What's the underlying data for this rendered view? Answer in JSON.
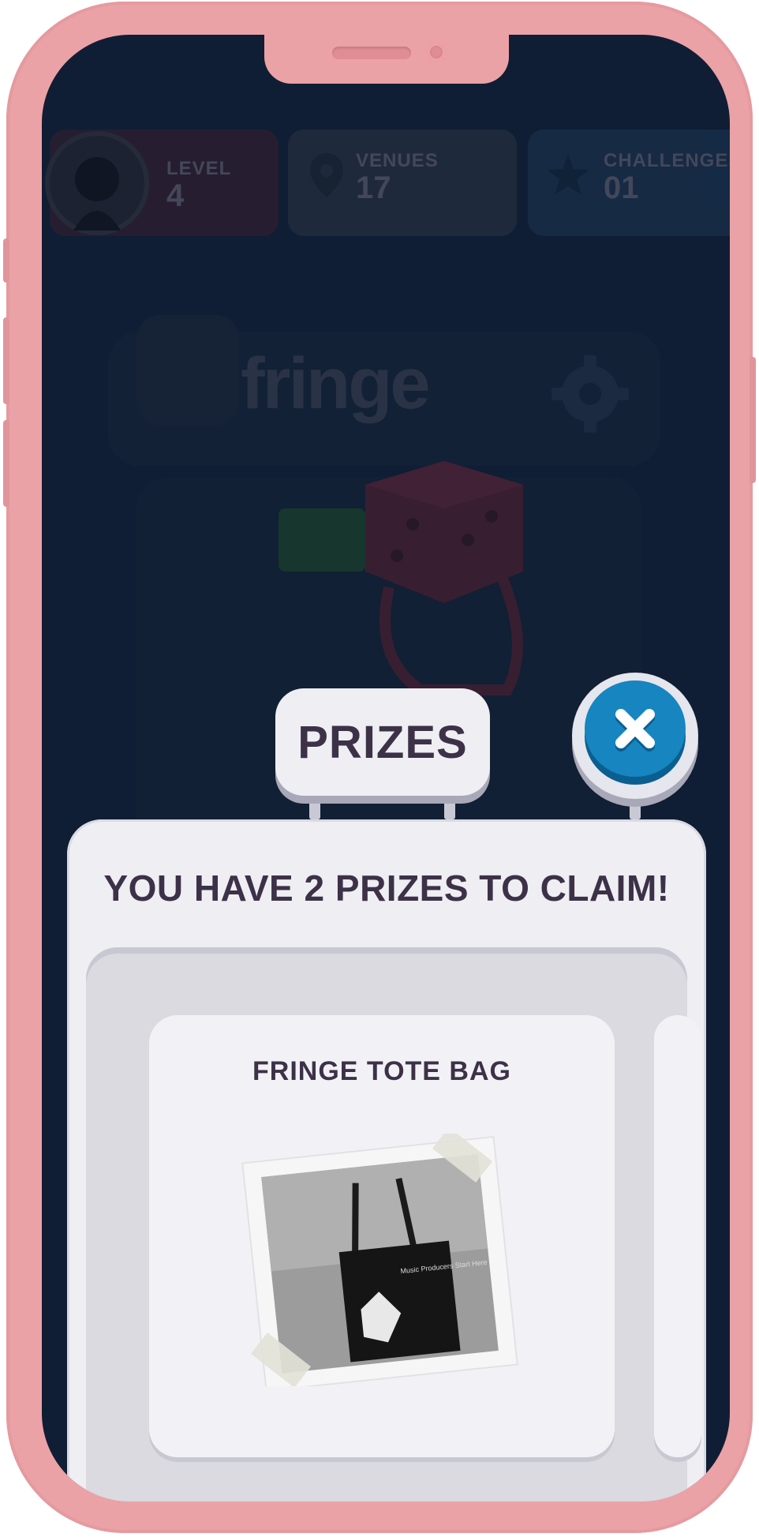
{
  "stats": {
    "level": {
      "label": "LEVEL",
      "value": "4"
    },
    "venues": {
      "label": "VENUES",
      "value": "17"
    },
    "challenges": {
      "label": "CHALLENGES",
      "value": "01"
    }
  },
  "brand": "fringe",
  "modal": {
    "title": "PRIZES",
    "heading": "YOU HAVE 2 PRIZES TO CLAIM!",
    "prizes": [
      {
        "name": "FRINGE TOTE BAG",
        "image_icon": "tote-bag-photo",
        "bag_text": "Music Producers Start Here"
      }
    ],
    "close_icon": "close-icon"
  },
  "colors": {
    "frame": "#eba2a6",
    "screen": "#0f1e34",
    "close_button": "#1685c0",
    "text_dark": "#3d3148",
    "card": "#eeeef3"
  }
}
